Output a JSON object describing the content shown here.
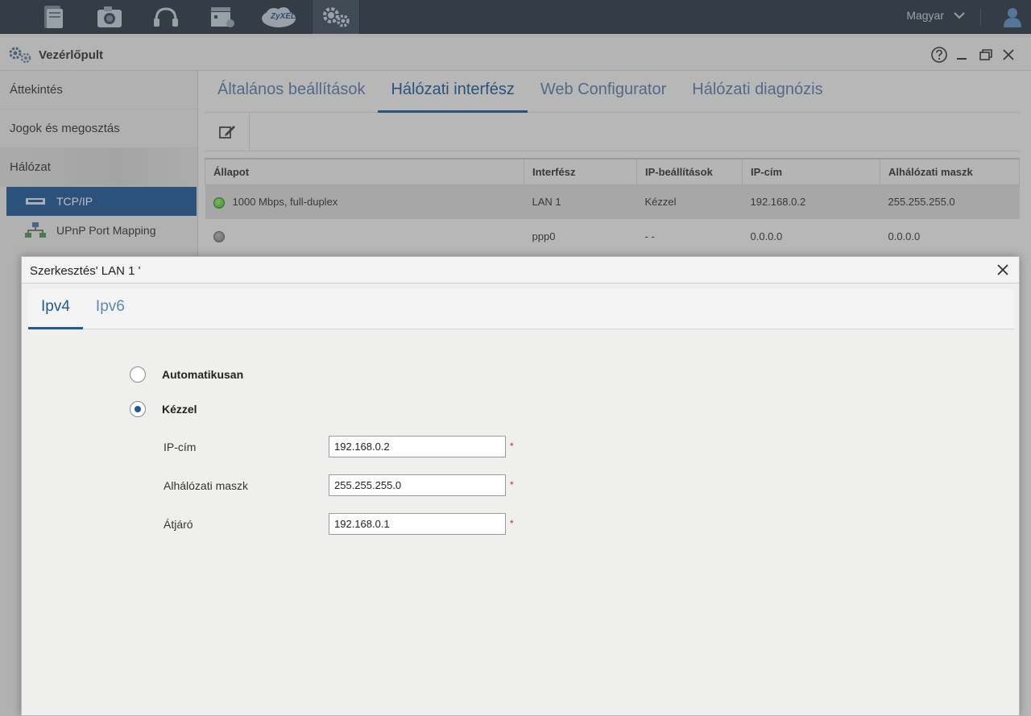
{
  "topbar": {
    "apps": [
      "file-browser-icon",
      "photo-icon",
      "music-icon",
      "video-icon",
      "zyxel-cloud-icon",
      "control-panel-icon"
    ],
    "zyxel_label": "ZyXEL",
    "language": "Magyar"
  },
  "window": {
    "title": "Vezérlőpult"
  },
  "sidebar": {
    "items": [
      {
        "label": "Áttekintés"
      },
      {
        "label": "Jogok és megosztás"
      },
      {
        "label": "Hálózat"
      }
    ],
    "sub_items": [
      {
        "label": "TCP/IP"
      },
      {
        "label": "UPnP Port Mapping"
      }
    ]
  },
  "main": {
    "tabs": [
      {
        "label": "Általános beállítások"
      },
      {
        "label": "Hálózati interfész"
      },
      {
        "label": "Web Configurator"
      },
      {
        "label": "Hálózati diagnózis"
      }
    ],
    "table": {
      "headers": [
        "Állapot",
        "Interfész",
        "IP-beállítások",
        "IP-cím",
        "Alhálózati maszk"
      ],
      "rows": [
        {
          "status": "1000 Mbps, full-duplex",
          "status_color": "#3fb51c",
          "interface": "LAN 1",
          "ip_settings": "Kézzel",
          "ip": "192.168.0.2",
          "mask": "255.255.255.0"
        },
        {
          "status": "",
          "status_color": "#7a7a7a",
          "interface": "ppp0",
          "ip_settings": "- -",
          "ip": "0.0.0.0",
          "mask": "0.0.0.0"
        }
      ]
    }
  },
  "dialog": {
    "title": "Szerkesztés' LAN 1 '",
    "tabs": [
      {
        "label": "Ipv4"
      },
      {
        "label": "Ipv6"
      }
    ],
    "options": {
      "auto": "Automatikusan",
      "manual": "Kézzel",
      "selected": "manual"
    },
    "fields": [
      {
        "label": "IP-cím",
        "value": "192.168.0.2"
      },
      {
        "label": "Alhálózati maszk",
        "value": "255.255.255.0"
      },
      {
        "label": "Átjáró",
        "value": "192.168.0.1"
      }
    ],
    "required_mark": "*"
  }
}
